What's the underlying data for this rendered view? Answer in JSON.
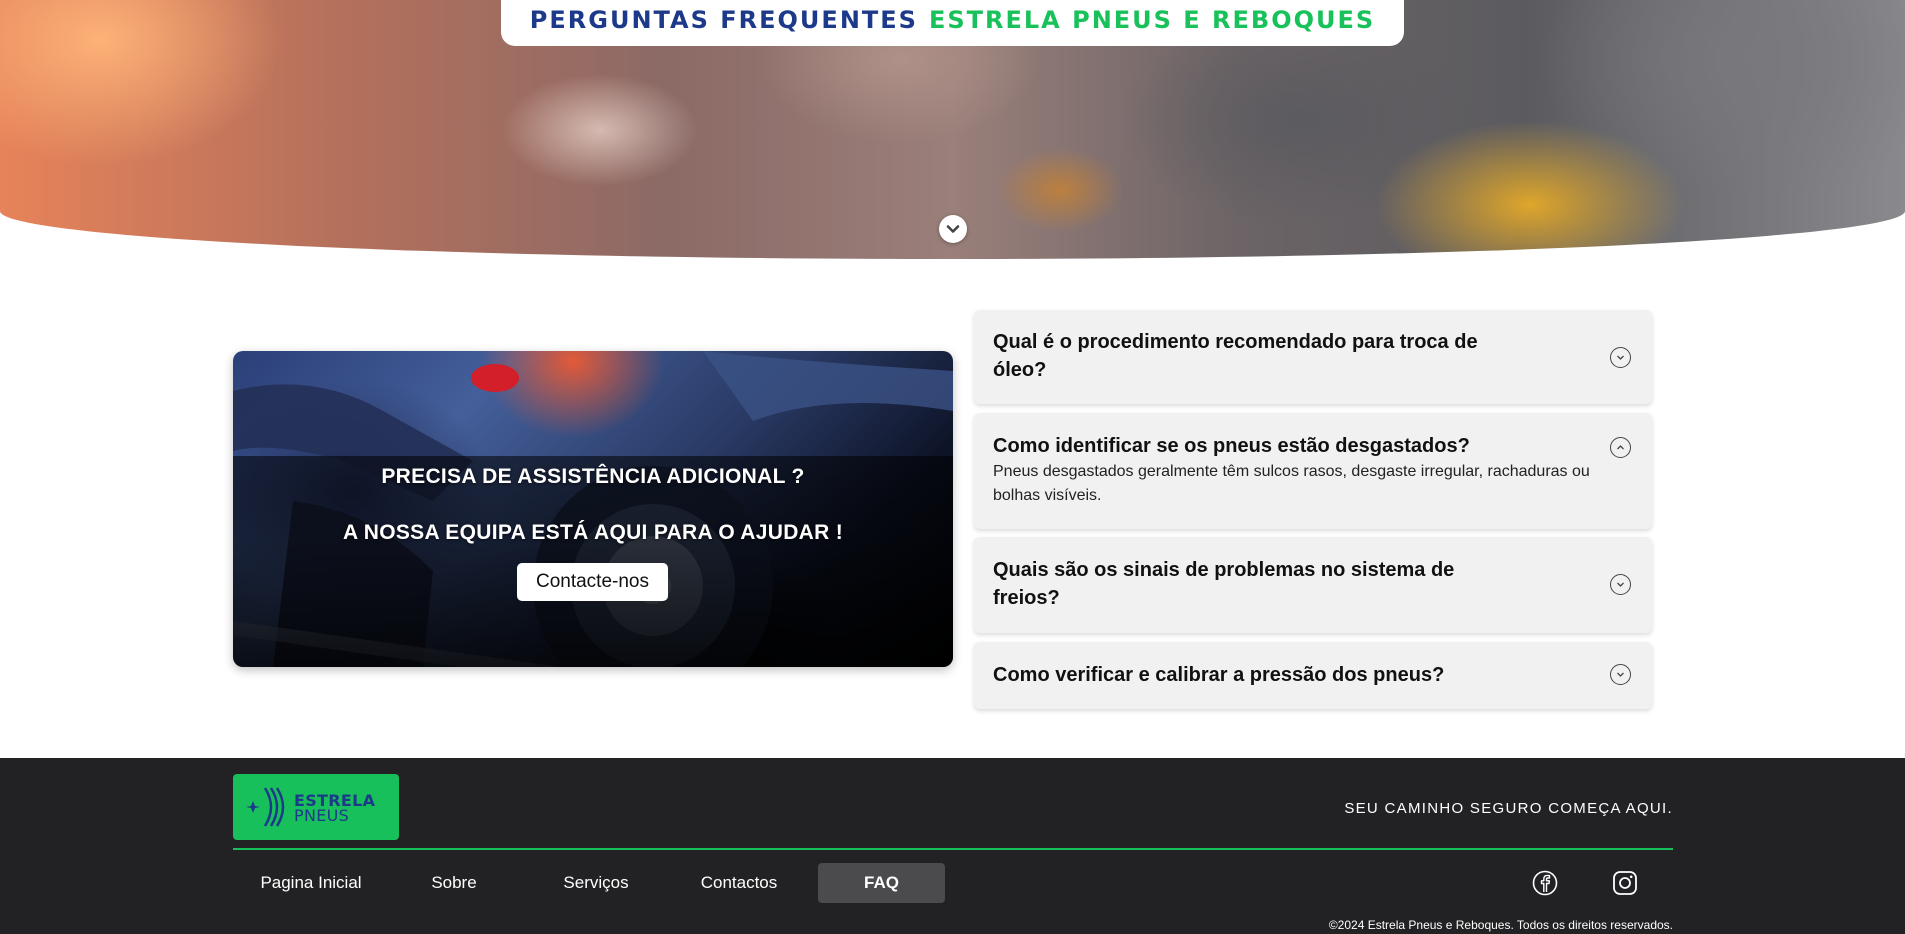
{
  "hero": {
    "title_part1": "PERGUNTAS FREQUENTES",
    "title_part2": "ESTRELA PNEUS E REBOQUES",
    "scroll_icon": "chevron-down-icon"
  },
  "cta": {
    "heading1": "PRECISA DE ASSISTÊNCIA ADICIONAL ?",
    "heading2": "A NOSSA EQUIPA ESTÁ AQUI PARA O AJUDAR !",
    "button_label": "Contacte-nos"
  },
  "faq": [
    {
      "question": "Qual é o procedimento recomendado para troca de óleo?",
      "answer": "",
      "expanded": false
    },
    {
      "question": "Como identificar se os pneus estão desgastados?",
      "answer": "Pneus desgastados geralmente têm sulcos rasos, desgaste irregular, rachaduras ou bolhas visíveis.",
      "expanded": true
    },
    {
      "question": "Quais são os sinais de problemas no sistema de freios?",
      "answer": "",
      "expanded": false
    },
    {
      "question": "Como verificar e calibrar a pressão dos pneus?",
      "answer": "",
      "expanded": false
    }
  ],
  "footer": {
    "logo_line1": "ESTRELA",
    "logo_line2": "PNEUS",
    "tagline": "SEU CAMINHO SEGURO COMEÇA AQUI.",
    "nav": [
      {
        "label": "Pagina Inicial",
        "active": false
      },
      {
        "label": "Sobre",
        "active": false
      },
      {
        "label": "Serviços",
        "active": false
      },
      {
        "label": "Contactos",
        "active": false
      },
      {
        "label": "FAQ",
        "active": true
      }
    ],
    "social": [
      "facebook-icon",
      "instagram-icon"
    ],
    "copyright": "©2024 Estrela Pneus e Reboques. Todos os direitos reservados."
  },
  "colors": {
    "brand_blue": "#1d3a8a",
    "brand_green": "#19c15a",
    "footer_bg": "#222224",
    "faq_bg": "#f1f1f1"
  }
}
